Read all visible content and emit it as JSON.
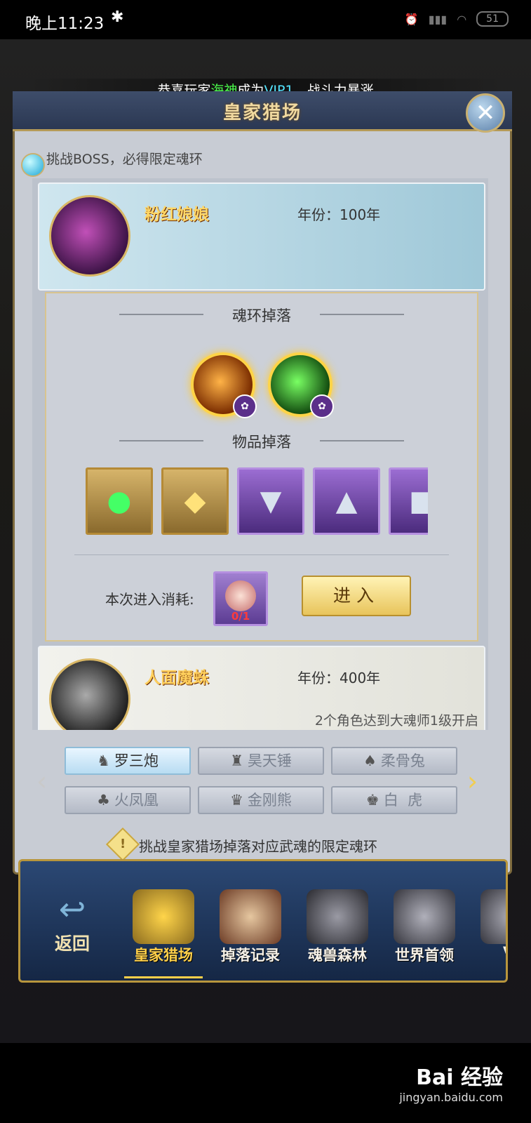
{
  "status_bar": {
    "time": "晚上11:23",
    "bluetooth_icon": "bluetooth-icon",
    "battery": "51"
  },
  "marquee": {
    "prefix": "恭喜玩家",
    "player": "海神",
    "mid": "成为",
    "vip": "VIP1",
    "suffix": "，战斗力暴涨"
  },
  "panel": {
    "title": "皇家猎场",
    "close_symbol": "✕",
    "subtitle": "挑战BOSS，必得限定魂环"
  },
  "bosses": [
    {
      "name": "粉红娘娘",
      "year": "年份：100年"
    },
    {
      "name": "人面魔蛛",
      "year": "年份：400年",
      "unlock": "2个角色达到大魂师1级开启"
    }
  ],
  "drops": {
    "soul_ring_title": "魂环掉落",
    "item_title": "物品掉落",
    "soul_rings": [
      {
        "icon": "fire-soul-ring-icon",
        "badge_icon": "rabbit-badge-icon"
      },
      {
        "icon": "grass-soul-ring-icon",
        "badge_icon": "rabbit-badge-icon"
      }
    ],
    "items": [
      {
        "icon": "green-orb-icon",
        "glyph": "●",
        "rarity": "gold"
      },
      {
        "icon": "gold-crystal-icon",
        "glyph": "◆",
        "rarity": "gold"
      },
      {
        "icon": "armor-boots-icon",
        "glyph": "▼",
        "rarity": "purple"
      },
      {
        "icon": "armor-helmet-icon",
        "glyph": "▲",
        "rarity": "purple"
      },
      {
        "icon": "armor-chest-icon",
        "glyph": "■",
        "rarity": "purple"
      }
    ]
  },
  "cost": {
    "label": "本次进入消耗:",
    "count": "0/1",
    "icon": "clown-ticket-icon"
  },
  "enter_button": "进入",
  "weapon_tabs": [
    {
      "label": "罗三炮",
      "icon": "luosanpao-icon",
      "glyph": "♞",
      "active": true
    },
    {
      "label": "昊天锤",
      "icon": "haotianchui-icon",
      "glyph": "♜",
      "active": false
    },
    {
      "label": "柔骨兔",
      "icon": "rabbit-icon",
      "glyph": "♠",
      "active": false
    },
    {
      "label": "火凤凰",
      "icon": "phoenix-icon",
      "glyph": "♣",
      "active": false
    },
    {
      "label": "金刚熊",
      "icon": "bear-icon",
      "glyph": "♛",
      "active": false
    },
    {
      "label": "白  虎",
      "icon": "tiger-icon",
      "glyph": "♚",
      "active": false
    }
  ],
  "arrows": {
    "left": "‹",
    "right": "›"
  },
  "tip": {
    "icon_text": "!",
    "text": "挑战皇家猎场掉落对应武魂的限定魂环"
  },
  "nav": {
    "back": "返回",
    "back_icon": "↩",
    "tabs": [
      {
        "label": "皇家猎场",
        "icon": "royal-hunt-icon",
        "active": true,
        "color": "#c8a23a"
      },
      {
        "label": "掉落记录",
        "icon": "drop-record-book-icon",
        "active": false,
        "color": "#8a5a3a"
      },
      {
        "label": "魂兽森林",
        "icon": "beast-forest-icon",
        "active": false,
        "color": "#4a4a52"
      },
      {
        "label": "世界首领",
        "icon": "world-boss-icon",
        "active": false,
        "color": "#5a5a64"
      },
      {
        "label": "VI",
        "icon": "vip-icon",
        "active": false,
        "color": "#5a5a64"
      }
    ]
  },
  "watermark": {
    "brand": "Bai 经验",
    "site": "jingyan.baidu.com"
  }
}
